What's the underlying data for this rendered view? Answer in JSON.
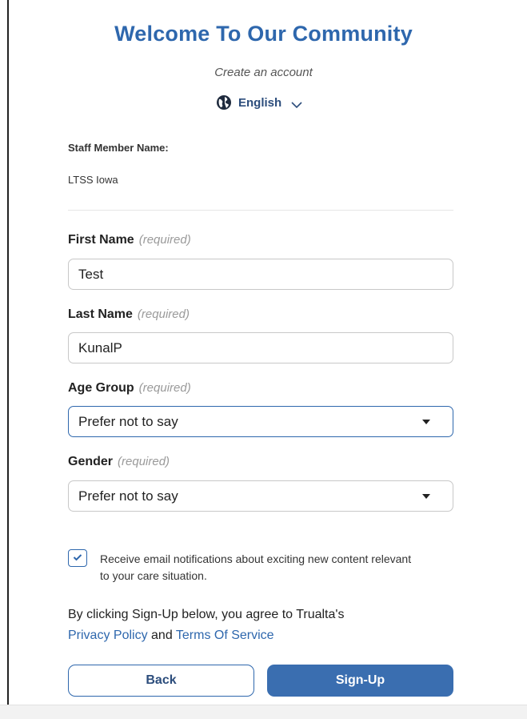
{
  "header": {
    "title": "Welcome To Our Community",
    "subtitle": "Create an account",
    "language": "English"
  },
  "staff": {
    "label": "Staff Member Name:",
    "value": "LTSS Iowa"
  },
  "form": {
    "required_hint": "(required)",
    "first_name": {
      "label": "First Name",
      "value": "Test"
    },
    "last_name": {
      "label": "Last Name",
      "value": "KunalP"
    },
    "age_group": {
      "label": "Age Group",
      "selected": "Prefer not to say"
    },
    "gender": {
      "label": "Gender",
      "selected": "Prefer not to say"
    },
    "email_opt_in": {
      "checked": true,
      "label": "Receive email notifications about exciting new content relevant to your care situation."
    }
  },
  "agreement": {
    "text_prefix": "By clicking Sign-Up below, you agree to Trualta's",
    "privacy_link": "Privacy Policy",
    "and": "and",
    "terms_link": "Terms Of Service"
  },
  "buttons": {
    "back": "Back",
    "signup": "Sign-Up"
  },
  "colors": {
    "accent": "#2e67ad",
    "button_fill": "#3a6eb0"
  },
  "icons": {
    "language": "globe-icon",
    "language_toggle": "chevron-down-icon",
    "select": "caret-down-icon",
    "checkbox": "checkmark-icon"
  }
}
